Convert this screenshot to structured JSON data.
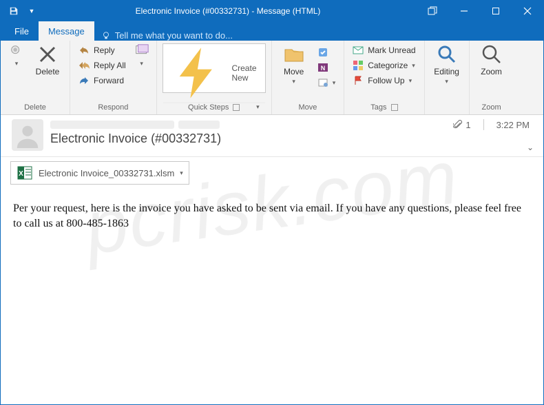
{
  "window": {
    "title": "Electronic Invoice (#00332731) - Message (HTML)"
  },
  "tabs": {
    "file": "File",
    "message": "Message",
    "tell_me": "Tell me what you want to do..."
  },
  "ribbon": {
    "delete": {
      "big": "Delete",
      "group": "Delete"
    },
    "respond": {
      "reply": "Reply",
      "reply_all": "Reply All",
      "forward": "Forward",
      "group": "Respond"
    },
    "quicksteps": {
      "create_new": "Create New",
      "group": "Quick Steps"
    },
    "move": {
      "big": "Move",
      "group": "Move"
    },
    "tags": {
      "mark_unread": "Mark Unread",
      "categorize": "Categorize",
      "follow_up": "Follow Up",
      "group": "Tags"
    },
    "editing": {
      "big": "Editing",
      "group": ""
    },
    "zoom": {
      "big": "Zoom",
      "group": "Zoom"
    }
  },
  "message": {
    "subject": "Electronic Invoice (#00332731)",
    "attachment_count": "1",
    "time": "3:22 PM",
    "attachment_name": "Electronic Invoice_00332731.xlsm",
    "body": "Per your request, here is the invoice you have asked to be sent via email. If you have any questions, please feel free to call us at 800-485-1863"
  },
  "watermark": "pcrisk.com"
}
